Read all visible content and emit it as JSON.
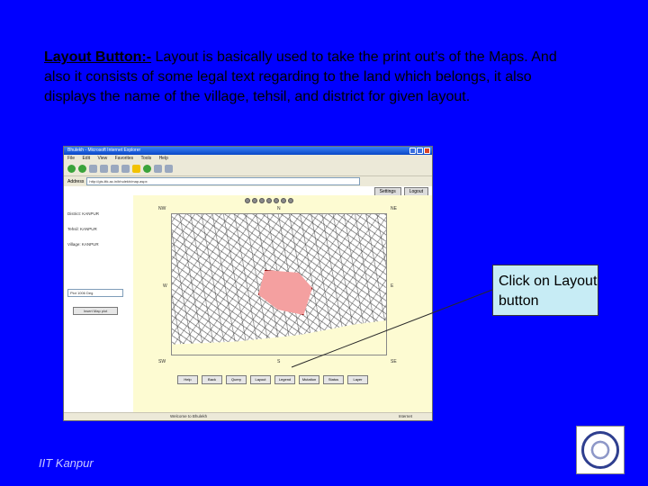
{
  "caption": {
    "lead": "Layout Button",
    "separator": ":-",
    "body": " Layout is basically used to take the print out’s of the Maps. And also it consists of some legal text regarding to the land which belongs, it also displays the name of the village, tehsil, and district for given layout."
  },
  "screenshot": {
    "title": "Bhulekh - Microsoft Internet Explorer",
    "menu": [
      "File",
      "Edit",
      "View",
      "Favorites",
      "Tools",
      "Help"
    ],
    "address_label": "Address",
    "address": "http://gis.iitk.ac.in/bhulekh/map.aspx",
    "top_buttons": [
      "Settings",
      "Logout"
    ],
    "left_panel": {
      "district": "District: KANPUR",
      "tehsil": "Tehsil: KANPUR",
      "village": "Village: KANPUR",
      "select_value": "Plot 1006 Deg",
      "button": "Insert Map plot"
    },
    "directions": [
      "NW",
      "N",
      "NE",
      "W",
      "E",
      "SW",
      "S",
      "SE"
    ],
    "bottom_buttons": [
      "Help",
      "Back",
      "Query",
      "Layout",
      "Legend",
      "Mutation",
      "Status",
      "Layer"
    ],
    "status": "Welcome to Bhulekh",
    "zone": "Internet"
  },
  "callout": {
    "text": "Click on Layout button"
  },
  "footer": {
    "text": "IIT Kanpur"
  },
  "colors": {
    "background": "#0000ff",
    "callout": "#c7ecf5",
    "parcel": "#f4a0a0",
    "map_panel": "#fdfbd2"
  }
}
